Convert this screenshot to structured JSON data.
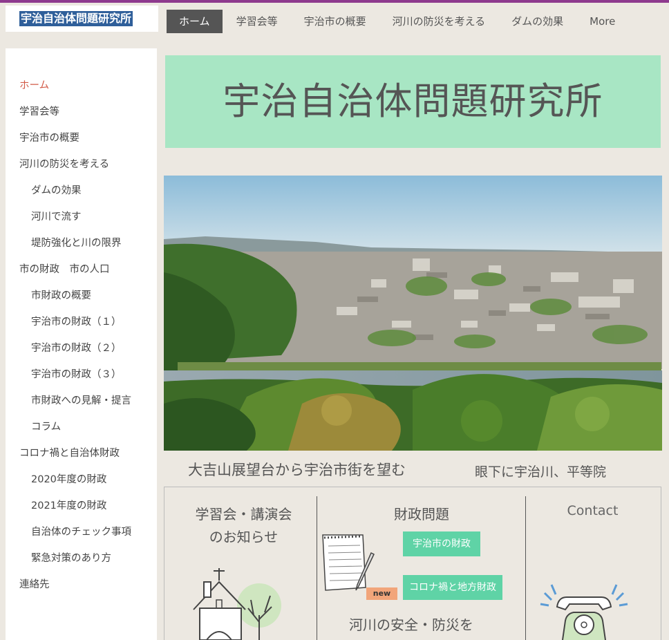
{
  "site_title": "宇治自治体問題研究所",
  "topnav": {
    "items": [
      "ホーム",
      "学習会等",
      "宇治市の概要",
      "河川の防災を考える",
      "ダムの効果",
      "More"
    ],
    "active_index": 0
  },
  "sidebar": {
    "items": [
      {
        "label": "ホーム",
        "level": 0,
        "active": true
      },
      {
        "label": "学習会等",
        "level": 0
      },
      {
        "label": "宇治市の概要",
        "level": 0
      },
      {
        "label": "河川の防災を考える",
        "level": 0
      },
      {
        "label": "ダムの効果",
        "level": 1
      },
      {
        "label": "河川で流す",
        "level": 1
      },
      {
        "label": "堤防強化と川の限界",
        "level": 1
      },
      {
        "label": "市の財政　市の人口",
        "level": 0
      },
      {
        "label": "市財政の概要",
        "level": 1
      },
      {
        "label": "宇治市の財政（１）",
        "level": 1
      },
      {
        "label": "宇治市の財政（２）",
        "level": 1
      },
      {
        "label": "宇治市の財政（３）",
        "level": 1
      },
      {
        "label": "市財政への見解・提言",
        "level": 1
      },
      {
        "label": "コラム",
        "level": 1
      },
      {
        "label": "コロナ禍と自治体財政",
        "level": 0
      },
      {
        "label": "2020年度の財政",
        "level": 1
      },
      {
        "label": "2021年度の財政",
        "level": 1
      },
      {
        "label": "自治体のチェック事項",
        "level": 1
      },
      {
        "label": "緊急対策のあり方",
        "level": 1
      },
      {
        "label": "連絡先",
        "level": 0
      }
    ]
  },
  "banner": {
    "title": "宇治自治体問題研究所",
    "color": "#a8e6c4"
  },
  "photo": {
    "caption": "大吉山展望台から宇治市街を望む",
    "sub_caption": "眼下に宇治川、平等院"
  },
  "columns": {
    "study": {
      "title_line1": "学習会・講演会",
      "title_line2": "のお知らせ"
    },
    "finance": {
      "title": "財政問題",
      "button1": "宇治市の財政",
      "button2": "コロナ禍と地方財政",
      "new_badge": "new",
      "river_text": "河川の安全・防災を"
    },
    "contact": {
      "title": "Contact"
    }
  },
  "colors": {
    "accent": "#d25a47",
    "nav_active": "#555555",
    "button_green": "#5fd3a6",
    "new_badge": "#f2a57a",
    "top_bar": "#8e3a8e"
  }
}
